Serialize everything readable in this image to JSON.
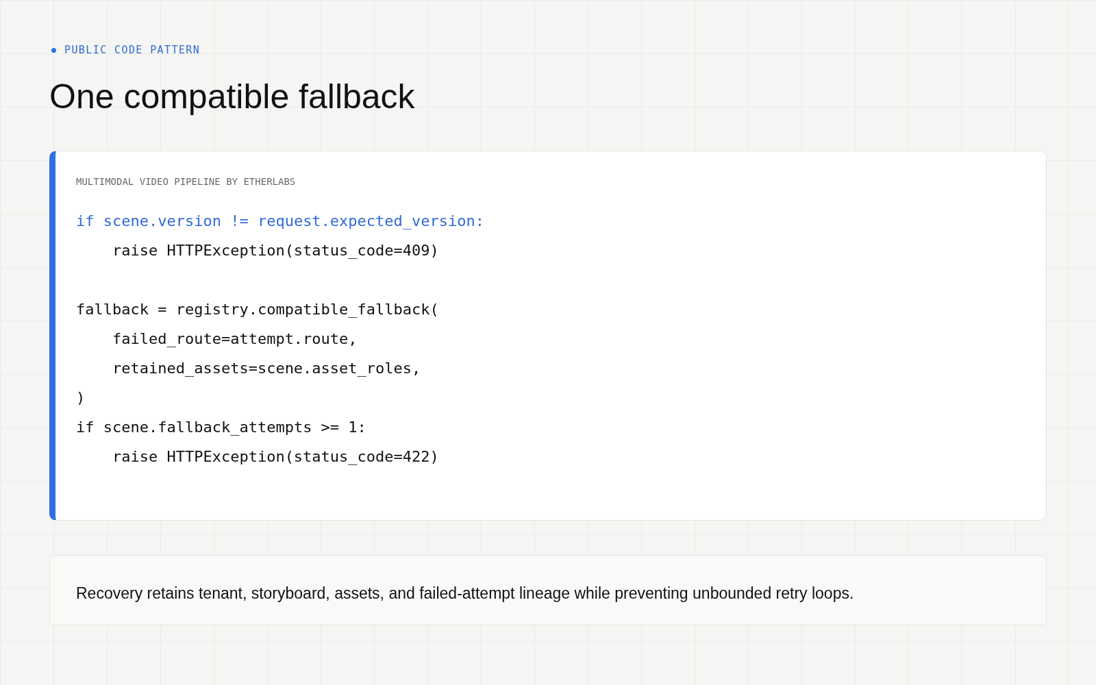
{
  "eyebrow": {
    "label": "PUBLIC CODE PATTERN"
  },
  "title": "One compatible fallback",
  "code_card": {
    "caption": "MULTIMODAL VIDEO PIPELINE BY ETHERLABS",
    "blocks": [
      {
        "lines": [
          {
            "text": "if scene.version != request.expected_version:",
            "highlighted": true,
            "children": [
              {
                "text": "raise HTTPException(status_code=409)",
                "highlighted": false
              }
            ]
          }
        ]
      },
      {
        "lines": [
          {
            "text": "fallback = registry.compatible_fallback(",
            "highlighted": false,
            "children": [
              {
                "text": "failed_route=attempt.route,",
                "highlighted": false
              },
              {
                "text": "retained_assets=scene.asset_roles,",
                "highlighted": false
              }
            ]
          },
          {
            "text": ")",
            "highlighted": false
          },
          {
            "text": "if scene.fallback_attempts >= 1:",
            "highlighted": false,
            "children": [
              {
                "text": "raise HTTPException(status_code=422)",
                "highlighted": false
              }
            ]
          }
        ]
      }
    ]
  },
  "note": {
    "text": "Recovery retains tenant, storyboard, assets, and failed-attempt lineage while preventing unbounded retry loops."
  }
}
